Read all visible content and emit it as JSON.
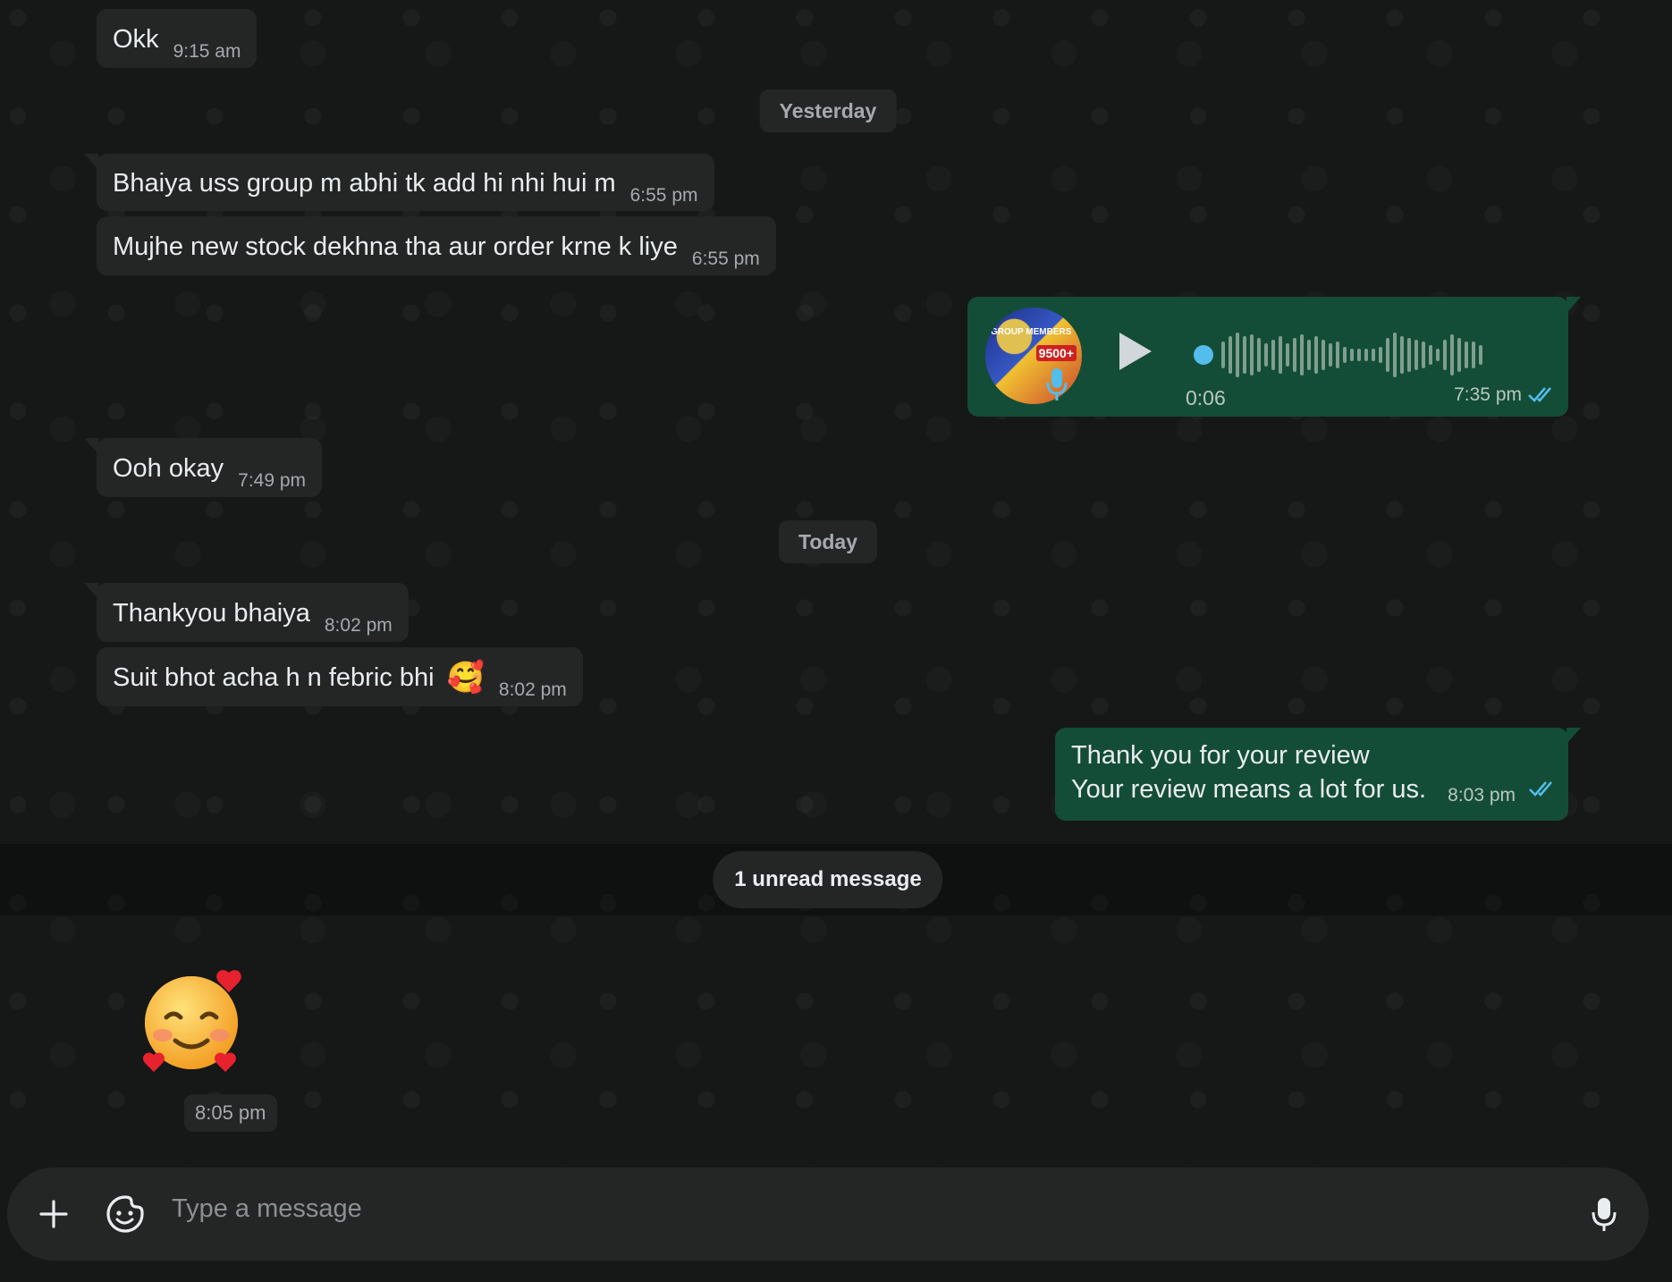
{
  "messages": {
    "m1": {
      "text": "Okk",
      "time": "9:15 am"
    },
    "day_yesterday": "Yesterday",
    "m2": {
      "text": "Bhaiya uss group m abhi tk add hi nhi hui m",
      "time": "6:55 pm"
    },
    "m3": {
      "text": "Mujhe new stock dekhna tha aur order krne k liye",
      "time": "6:55 pm"
    },
    "voice": {
      "duration": "0:06",
      "time": "7:35 pm",
      "avatar_badge": "9500+",
      "avatar_caption": "GROUP MEMBERS"
    },
    "m4": {
      "text": "Ooh okay",
      "time": "7:49 pm"
    },
    "day_today": "Today",
    "m5": {
      "text": "Thankyou bhaiya",
      "time": "8:02 pm"
    },
    "m6": {
      "text": "Suit bhot acha h n febric bhi",
      "emoji": "🥰",
      "time": "8:02 pm"
    },
    "m7": {
      "line1": "Thank you for your review",
      "line2": "Your review means a lot for us.",
      "time": "8:03 pm"
    },
    "unread": "1 unread message",
    "sticker": {
      "emoji": "🥰",
      "time": "8:05 pm"
    }
  },
  "composer": {
    "placeholder": "Type a message",
    "attach_icon": "plus-icon",
    "sticker_icon": "sticker-icon",
    "mic_icon": "microphone-icon"
  },
  "colors": {
    "background": "#161717",
    "incoming_bubble": "#242626",
    "outgoing_bubble": "#144d37",
    "read_ticks": "#53bdeb"
  }
}
